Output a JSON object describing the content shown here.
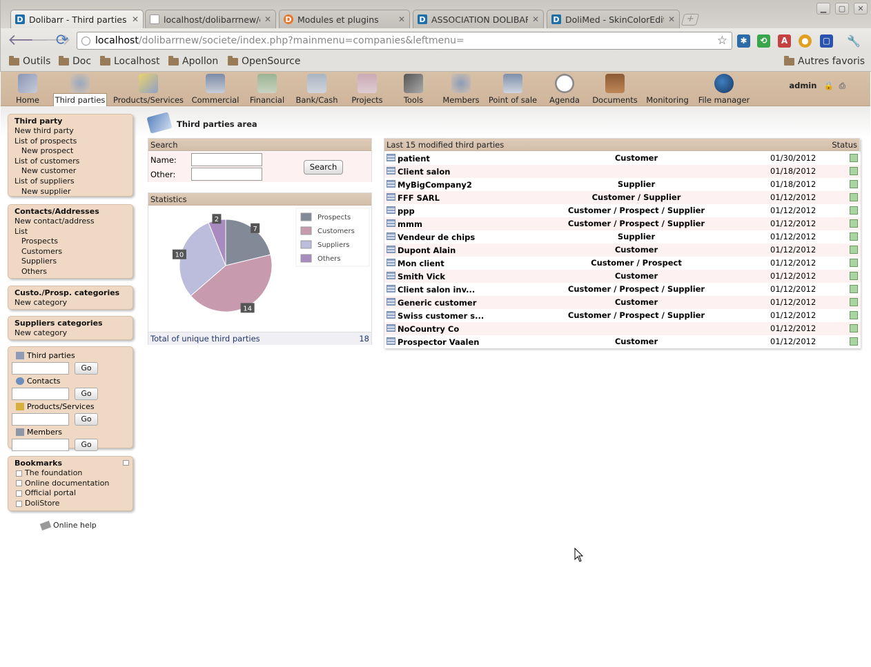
{
  "browser": {
    "tabs": [
      {
        "title": "Dolibarr - Third parties",
        "icon": "dolibarr-icon",
        "active": true
      },
      {
        "title": "localhost/dolibarrnew/cus",
        "icon": "document-icon",
        "active": false
      },
      {
        "title": "Modules et plugins",
        "icon": "plugin-icon",
        "active": false
      },
      {
        "title": "ASSOCIATION DOLIBARR -",
        "icon": "dolibarr-icon",
        "active": false
      },
      {
        "title": "DoliMed - SkinColorEditor",
        "icon": "dolibarr-icon",
        "active": false
      }
    ],
    "url_host": "localhost",
    "url_path": "/dolibarrnew/societe/index.php?mainmenu=companies&leftmenu=",
    "bookmarks": [
      "Outils",
      "Doc",
      "Localhost",
      "Apollon",
      "OpenSource"
    ],
    "other_bookmarks": "Autres favoris"
  },
  "topmenu": {
    "items": [
      "Home",
      "Third parties",
      "Products/Services",
      "Commercial",
      "Financial",
      "Bank/Cash",
      "Projects",
      "Tools",
      "Members",
      "Point of sale",
      "Agenda",
      "Documents",
      "Monitoring",
      "File manager"
    ],
    "selected": "Third parties",
    "user": "admin"
  },
  "left": {
    "third_party": {
      "title": "Third party",
      "items": [
        "New third party",
        "List of prospects",
        "New prospect",
        "List of customers",
        "New customer",
        "List of suppliers",
        "New supplier"
      ]
    },
    "contacts": {
      "title": "Contacts/Addresses",
      "items": [
        "New contact/address",
        "List",
        "Prospects",
        "Customers",
        "Suppliers",
        "Others"
      ]
    },
    "custo_categories": {
      "title": "Custo./Prosp. categories",
      "items": [
        "New category"
      ]
    },
    "supplier_categories": {
      "title": "Suppliers categories",
      "items": [
        "New category"
      ]
    },
    "quicksearch": {
      "labels": [
        "Third parties",
        "Contacts",
        "Products/Services",
        "Members"
      ],
      "go": "Go"
    },
    "bookmarks": {
      "title": "Bookmarks",
      "items": [
        "The foundation",
        "Online documentation",
        "Official portal",
        "DoliStore"
      ]
    },
    "online_help": "Online help"
  },
  "main": {
    "title": "Third parties area",
    "search": {
      "header": "Search",
      "name_label": "Name:",
      "other_label": "Other:",
      "button": "Search"
    },
    "statistics": {
      "header": "Statistics",
      "total_label": "Total of unique third parties",
      "total": "18"
    },
    "last_modified": {
      "header": "Last 15 modified third parties",
      "status_header": "Status",
      "rows": [
        {
          "name": "patient",
          "type": "Customer",
          "date": "01/30/2012"
        },
        {
          "name": "Client salon",
          "type": "",
          "date": "01/18/2012"
        },
        {
          "name": "MyBigCompany2",
          "type": "Supplier",
          "date": "01/18/2012"
        },
        {
          "name": "FFF SARL",
          "type": "Customer / Supplier",
          "date": "01/12/2012"
        },
        {
          "name": "ppp",
          "type": "Customer / Prospect / Supplier",
          "date": "01/12/2012"
        },
        {
          "name": "mmm",
          "type": "Customer / Prospect / Supplier",
          "date": "01/12/2012"
        },
        {
          "name": "Vendeur de chips",
          "type": "Supplier",
          "date": "01/12/2012"
        },
        {
          "name": "Dupont Alain",
          "type": "Customer",
          "date": "01/12/2012"
        },
        {
          "name": "Mon client",
          "type": "Customer / Prospect",
          "date": "01/12/2012"
        },
        {
          "name": "Smith Vick",
          "type": "Customer",
          "date": "01/12/2012"
        },
        {
          "name": "Client salon inv...",
          "type": "Customer / Prospect / Supplier",
          "date": "01/12/2012"
        },
        {
          "name": "Generic customer",
          "type": "Customer",
          "date": "01/12/2012"
        },
        {
          "name": "Swiss customer s...",
          "type": "Customer / Prospect / Supplier",
          "date": "01/12/2012"
        },
        {
          "name": "NoCountry Co",
          "type": "",
          "date": "01/12/2012"
        },
        {
          "name": "Prospector Vaalen",
          "type": "Customer",
          "date": "01/12/2012"
        }
      ]
    }
  },
  "chart_data": {
    "type": "pie",
    "categories": [
      "Prospects",
      "Customers",
      "Suppliers",
      "Others"
    ],
    "values": [
      7,
      14,
      10,
      2
    ],
    "colors": [
      "#828a97",
      "#c79aae",
      "#bcbcdc",
      "#a88cc0"
    ],
    "legend": "top-right"
  }
}
